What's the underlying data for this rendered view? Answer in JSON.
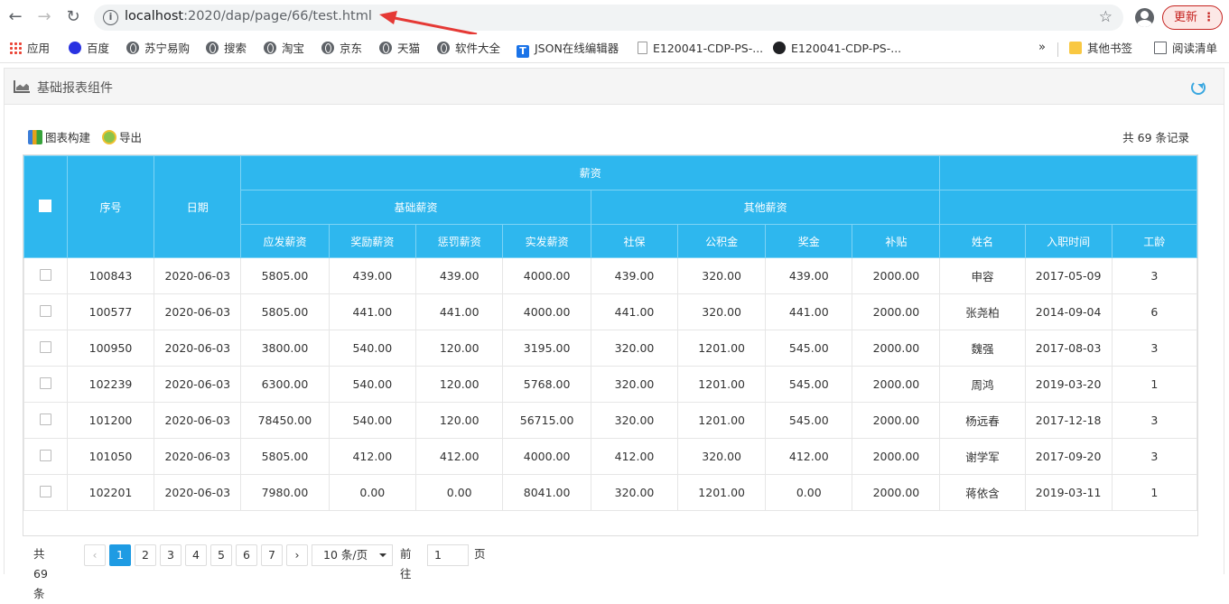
{
  "browser": {
    "url_host": "localhost",
    "url_rest": ":2020/dap/page/66/test.html",
    "update_label": "更新",
    "bookmarks": [
      {
        "label": "应用",
        "icon": "apps-grid-icon"
      },
      {
        "label": "百度",
        "icon": "baidu-paw-icon"
      },
      {
        "label": "苏宁易购",
        "icon": "globe-icon"
      },
      {
        "label": "搜索",
        "icon": "globe-icon"
      },
      {
        "label": "淘宝",
        "icon": "globe-icon"
      },
      {
        "label": "京东",
        "icon": "globe-icon"
      },
      {
        "label": "天猫",
        "icon": "globe-icon"
      },
      {
        "label": "软件大全",
        "icon": "globe-icon"
      },
      {
        "label": "JSON在线编辑器",
        "icon": "json-t-icon"
      },
      {
        "label": "E120041-CDP-PS-...",
        "icon": "document-icon"
      },
      {
        "label": "E120041-CDP-PS-...",
        "icon": "dark-circle-icon"
      }
    ],
    "more": "»",
    "other_bookmarks": "其他书签",
    "reading_list": "阅读清单"
  },
  "panel": {
    "title": "基础报表组件",
    "toolbar": {
      "build_label": "图表构建",
      "export_label": "导出"
    },
    "total_records": "共 69 条记录"
  },
  "table": {
    "headers": {
      "seq": "序号",
      "date": "日期",
      "salary": "薪资",
      "basic": "基础薪资",
      "other": "其他薪资",
      "cols": [
        "应发薪资",
        "奖励薪资",
        "惩罚薪资",
        "实发薪资",
        "社保",
        "公积金",
        "奖金",
        "补贴",
        "姓名",
        "入职时间",
        "工龄"
      ]
    },
    "rows": [
      {
        "seq": "100843",
        "date": "2020-06-03",
        "c": [
          "5805.00",
          "439.00",
          "439.00",
          "4000.00",
          "439.00",
          "320.00",
          "439.00",
          "2000.00",
          "申容",
          "2017-05-09",
          "3"
        ]
      },
      {
        "seq": "100577",
        "date": "2020-06-03",
        "c": [
          "5805.00",
          "441.00",
          "441.00",
          "4000.00",
          "441.00",
          "320.00",
          "441.00",
          "2000.00",
          "张尧柏",
          "2014-09-04",
          "6"
        ]
      },
      {
        "seq": "100950",
        "date": "2020-06-03",
        "c": [
          "3800.00",
          "540.00",
          "120.00",
          "3195.00",
          "320.00",
          "1201.00",
          "545.00",
          "2000.00",
          "魏强",
          "2017-08-03",
          "3"
        ]
      },
      {
        "seq": "102239",
        "date": "2020-06-03",
        "c": [
          "6300.00",
          "540.00",
          "120.00",
          "5768.00",
          "320.00",
          "1201.00",
          "545.00",
          "2000.00",
          "周鸿",
          "2019-03-20",
          "1"
        ]
      },
      {
        "seq": "101200",
        "date": "2020-06-03",
        "c": [
          "78450.00",
          "540.00",
          "120.00",
          "56715.00",
          "320.00",
          "1201.00",
          "545.00",
          "2000.00",
          "杨远春",
          "2017-12-18",
          "3"
        ]
      },
      {
        "seq": "101050",
        "date": "2020-06-03",
        "c": [
          "5805.00",
          "412.00",
          "412.00",
          "4000.00",
          "412.00",
          "320.00",
          "412.00",
          "2000.00",
          "谢学军",
          "2017-09-20",
          "3"
        ]
      },
      {
        "seq": "102201",
        "date": "2020-06-03",
        "c": [
          "7980.00",
          "0.00",
          "0.00",
          "8041.00",
          "320.00",
          "1201.00",
          "0.00",
          "2000.00",
          "蒋依含",
          "2019-03-11",
          "1"
        ]
      }
    ]
  },
  "pager": {
    "total": "共 69 条",
    "prev": "‹",
    "pages": [
      "1",
      "2",
      "3",
      "4",
      "5",
      "6",
      "7"
    ],
    "next": "›",
    "page_size": "10 条/页",
    "goto_label": "前往",
    "goto_value": "1",
    "page_suffix": "页"
  }
}
